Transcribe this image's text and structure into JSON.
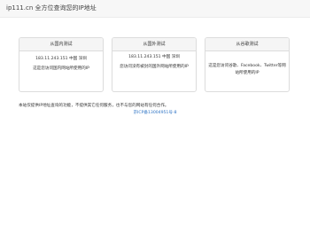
{
  "header": {
    "title": "ip111.cn 全方位查询您的IP地址"
  },
  "cards": [
    {
      "title": "从国内测试",
      "ip": "183.11.243.151 中国 深圳",
      "note": "这是您访问国内网站所使用的IP"
    },
    {
      "title": "从国外测试",
      "ip": "183.11.243.151 中国 深圳",
      "note": "您访问没有被封的国外网站所使用的IP"
    },
    {
      "title": "从谷歌测试",
      "ip": "",
      "note": "这是您访问谷歌、Facebook、Twitter等网站所使用的IP"
    }
  ],
  "footer": {
    "text": "本站仅提供IP地址查询的功能，不提供其它任何服务，也不与您的网站有任何合作。",
    "icp": "京ICP备13004951号-8"
  }
}
